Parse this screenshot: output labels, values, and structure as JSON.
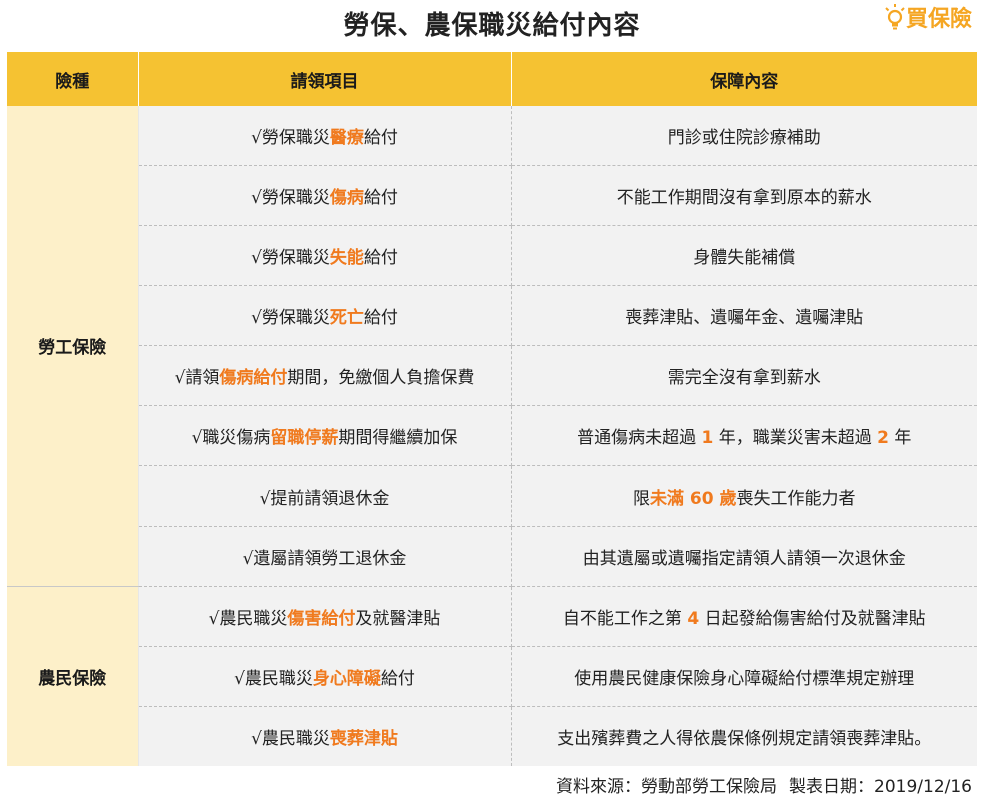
{
  "title": "勞保、農保職災給付內容",
  "logo": {
    "text": "買保險",
    "icon": "lightbulb-icon",
    "color": "#f5a623"
  },
  "table": {
    "headers": [
      "險種",
      "請領項目",
      "保障內容"
    ],
    "header_color": "#f5c232",
    "category_color": "#fdf0c9",
    "highlight_color": "#f07a1e",
    "groups": [
      {
        "category": "勞工保險",
        "rows": [
          {
            "item": [
              {
                "t": "√勞保職災"
              },
              {
                "t": "醫療",
                "hl": true
              },
              {
                "t": "給付"
              }
            ],
            "desc": [
              {
                "t": "門診或住院診療補助"
              }
            ]
          },
          {
            "item": [
              {
                "t": "√勞保職災"
              },
              {
                "t": "傷病",
                "hl": true
              },
              {
                "t": "給付"
              }
            ],
            "desc": [
              {
                "t": "不能工作期間沒有拿到原本的薪水"
              }
            ]
          },
          {
            "item": [
              {
                "t": "√勞保職災"
              },
              {
                "t": "失能",
                "hl": true
              },
              {
                "t": "給付"
              }
            ],
            "desc": [
              {
                "t": "身體失能補償"
              }
            ]
          },
          {
            "item": [
              {
                "t": "√勞保職災"
              },
              {
                "t": "死亡",
                "hl": true
              },
              {
                "t": "給付"
              }
            ],
            "desc": [
              {
                "t": "喪葬津貼、遺囑年金、遺囑津貼"
              }
            ]
          },
          {
            "item": [
              {
                "t": "√請領"
              },
              {
                "t": "傷病給付",
                "hl": true
              },
              {
                "t": "期間，免繳個人負擔保費"
              }
            ],
            "desc": [
              {
                "t": "需完全沒有拿到薪水"
              }
            ]
          },
          {
            "item": [
              {
                "t": "√職災傷病"
              },
              {
                "t": "留職停薪",
                "hl": true
              },
              {
                "t": "期間得繼續加保"
              }
            ],
            "desc": [
              {
                "t": "普通傷病未超過 "
              },
              {
                "t": "1",
                "hl": true
              },
              {
                "t": " 年，職業災害未超過 "
              },
              {
                "t": "2",
                "hl": true
              },
              {
                "t": " 年"
              }
            ]
          },
          {
            "item": [
              {
                "t": "√提前請領退休金"
              }
            ],
            "desc": [
              {
                "t": "限"
              },
              {
                "t": "未滿 60 歲",
                "hl": true
              },
              {
                "t": "喪失工作能力者"
              }
            ]
          },
          {
            "item": [
              {
                "t": "√遺屬請領勞工退休金"
              }
            ],
            "desc": [
              {
                "t": "由其遺屬或遺囑指定請領人請領一次退休金"
              }
            ]
          }
        ]
      },
      {
        "category": "農民保險",
        "rows": [
          {
            "item": [
              {
                "t": "√農民職災"
              },
              {
                "t": "傷害給付",
                "hl": true
              },
              {
                "t": "及就醫津貼"
              }
            ],
            "desc": [
              {
                "t": "自不能工作之第 "
              },
              {
                "t": "4",
                "hl": true
              },
              {
                "t": " 日起發給傷害給付及就醫津貼"
              }
            ]
          },
          {
            "item": [
              {
                "t": "√農民職災"
              },
              {
                "t": "身心障礙",
                "hl": true
              },
              {
                "t": "給付"
              }
            ],
            "desc": [
              {
                "t": "使用農民健康保險身心障礙給付標準規定辦理"
              }
            ]
          },
          {
            "item": [
              {
                "t": "√農民職災"
              },
              {
                "t": "喪葬津貼",
                "hl": true
              }
            ],
            "desc": [
              {
                "t": "支出殯葬費之人得依農保條例規定請領喪葬津貼。"
              }
            ]
          }
        ]
      }
    ]
  },
  "source": {
    "label": "資料來源：勞動部勞工保險局",
    "date": "製表日期：2019/12/16"
  }
}
